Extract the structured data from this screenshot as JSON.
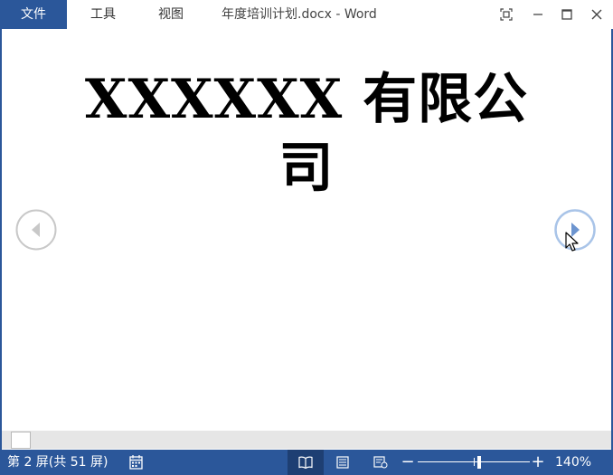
{
  "menu": {
    "file": "文件",
    "tools": "工具",
    "view": "视图"
  },
  "window": {
    "title": "年度培训计划.docx - Word"
  },
  "document": {
    "heading": "XXXXXX 有限公司"
  },
  "status": {
    "screen_count": "第 2 屏(共 51 屏)",
    "zoom_label": "140%",
    "zoom_percent": 140
  },
  "icons": {
    "fullscreen": "fullscreen-icon",
    "minimize": "minimize-icon",
    "maximize": "maximize-icon",
    "close": "close-icon",
    "prev": "prev-screen-icon",
    "next": "next-screen-icon",
    "proofing": "proofing-icon",
    "read_mode": "read-mode-icon",
    "print_layout": "print-layout-icon",
    "web_layout": "web-layout-icon"
  },
  "colors": {
    "accent": "#2b579a",
    "arrow_inactive": "#c8c8c8",
    "arrow_active": "#a9c4e8"
  }
}
